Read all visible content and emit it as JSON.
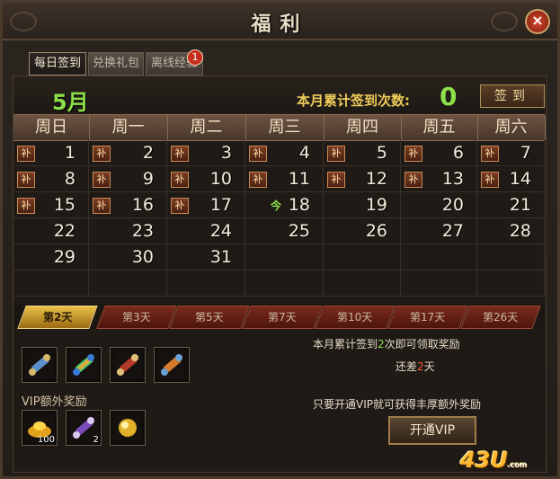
{
  "window": {
    "title": "福利"
  },
  "tabs": [
    {
      "label": "每日签到",
      "active": true
    },
    {
      "label": "兑换礼包",
      "active": false
    },
    {
      "label": "离线经验",
      "active": false
    }
  ],
  "badge_count": "1",
  "calendar": {
    "month": "5月",
    "count_label": "本月累计签到次数:",
    "count_value": "0",
    "sign_button": "签到",
    "weekdays": [
      "周日",
      "周一",
      "周二",
      "周三",
      "周四",
      "周五",
      "周六"
    ],
    "makeup_label": "补",
    "today_label": "今",
    "weeks": [
      [
        {
          "d": "1",
          "bu": true
        },
        {
          "d": "2",
          "bu": true
        },
        {
          "d": "3",
          "bu": true
        },
        {
          "d": "4",
          "bu": true
        },
        {
          "d": "5",
          "bu": true
        },
        {
          "d": "6",
          "bu": true
        },
        {
          "d": "7",
          "bu": true
        }
      ],
      [
        {
          "d": "8",
          "bu": true
        },
        {
          "d": "9",
          "bu": true
        },
        {
          "d": "10",
          "bu": true
        },
        {
          "d": "11",
          "bu": true
        },
        {
          "d": "12",
          "bu": true
        },
        {
          "d": "13",
          "bu": true
        },
        {
          "d": "14",
          "bu": true
        }
      ],
      [
        {
          "d": "15",
          "bu": true
        },
        {
          "d": "16",
          "bu": true
        },
        {
          "d": "17",
          "bu": true
        },
        {
          "d": "18",
          "today": true
        },
        {
          "d": "19"
        },
        {
          "d": "20"
        },
        {
          "d": "21"
        }
      ],
      [
        {
          "d": "22"
        },
        {
          "d": "23"
        },
        {
          "d": "24"
        },
        {
          "d": "25"
        },
        {
          "d": "26"
        },
        {
          "d": "27"
        },
        {
          "d": "28"
        }
      ],
      [
        {
          "d": "29"
        },
        {
          "d": "30"
        },
        {
          "d": "31"
        },
        {
          "d": ""
        },
        {
          "d": ""
        },
        {
          "d": ""
        },
        {
          "d": ""
        }
      ],
      [
        {
          "d": ""
        },
        {
          "d": ""
        },
        {
          "d": ""
        },
        {
          "d": ""
        },
        {
          "d": ""
        },
        {
          "d": ""
        },
        {
          "d": ""
        }
      ]
    ]
  },
  "reward_tabs": [
    {
      "label": "第2天",
      "active": true
    },
    {
      "label": "第3天"
    },
    {
      "label": "第5天"
    },
    {
      "label": "第7天"
    },
    {
      "label": "第10天"
    },
    {
      "label": "第17天"
    },
    {
      "label": "第26天"
    }
  ],
  "reward_items": [
    {
      "icon": "scroll-blue-icon"
    },
    {
      "icon": "scroll-rainbow-icon"
    },
    {
      "icon": "scroll-red-icon"
    },
    {
      "icon": "scroll-fire-icon"
    }
  ],
  "vip": {
    "title": "VIP额外奖励",
    "items": [
      {
        "icon": "gold-ingot-icon",
        "qty": "100"
      },
      {
        "icon": "scroll-purple-icon",
        "qty": "2"
      },
      {
        "icon": "gold-orb-icon",
        "qty": ""
      }
    ],
    "button": "开通VIP"
  },
  "info": {
    "line1_a": "本月累计签到",
    "line1_num": "2",
    "line1_b": "次即可领取奖励",
    "line2_a": "还差",
    "line2_num": "2",
    "line2_b": "天",
    "line3": "只要开通VIP就可获得丰厚额外奖励"
  },
  "logo": {
    "main": "43U",
    "sub": ".com"
  },
  "colors": {
    "accent_green": "#8ee04a",
    "gold": "#efcc5a",
    "red": "#c72d1c"
  }
}
